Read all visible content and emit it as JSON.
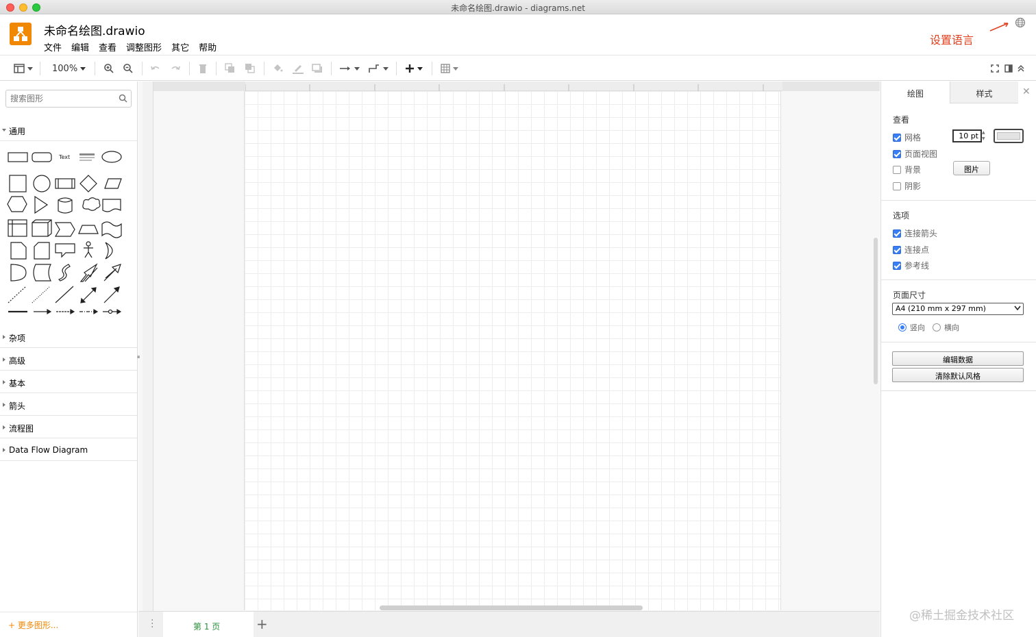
{
  "window": {
    "title": "未命名绘图.drawio - diagrams.net"
  },
  "header": {
    "doc_title": "未命名绘图.drawio",
    "menu": [
      "文件",
      "编辑",
      "查看",
      "调整图形",
      "其它",
      "帮助"
    ],
    "annotation": "设置语言"
  },
  "toolbar": {
    "zoom": "100%"
  },
  "sidebar": {
    "search_placeholder": "搜索图形",
    "sections": {
      "general": "通用",
      "misc": "杂项",
      "advanced": "高级",
      "basic": "基本",
      "arrows": "箭头",
      "flowchart": "流程图",
      "dfd": "Data Flow Diagram"
    },
    "text_shape_label": "Text",
    "more_shapes": "+ 更多图形..."
  },
  "footer": {
    "page_tab": "第 1 页",
    "add_page": "+"
  },
  "right_panel": {
    "tabs": {
      "diagram": "绘图",
      "style": "样式"
    },
    "view_heading": "查看",
    "grid_label": "网格",
    "grid_size": "10 pt",
    "page_view_label": "页面视图",
    "background_label": "背景",
    "image_button": "图片",
    "shadow_label": "阴影",
    "options_heading": "选项",
    "connection_arrows": "连接箭头",
    "connection_points": "连接点",
    "guides": "参考线",
    "page_size_heading": "页面尺寸",
    "page_size_value": "A4 (210 mm x 297 mm)",
    "portrait": "竖向",
    "landscape": "横向",
    "edit_data": "编辑数据",
    "clear_default_style": "清除默认风格"
  },
  "watermark": "@稀土掘金技术社区",
  "colors": {
    "accent": "#f08705",
    "annotation": "#e0401e",
    "checkbox": "#3a7ef3"
  }
}
